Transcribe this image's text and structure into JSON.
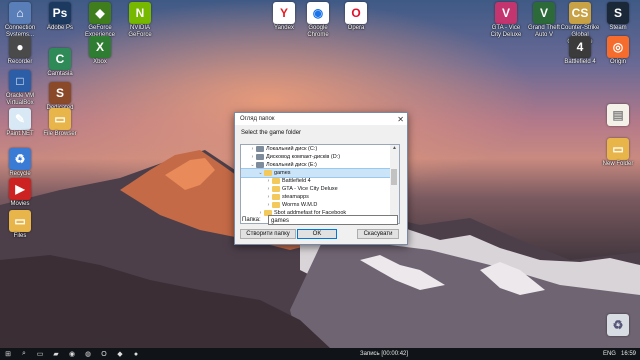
{
  "desktop": {
    "left_icons": [
      {
        "label": "Connection Systems...",
        "icon": "computer-icon",
        "color": "#5a7fb8",
        "glyph": "⌂"
      },
      {
        "label": "Oracle VM VirtualBox",
        "icon": "virtualbox-icon",
        "color": "#2b5ea7",
        "glyph": "□"
      },
      {
        "label": "Paint.NET",
        "icon": "paint-icon",
        "color": "#d9e8f5",
        "glyph": "✎"
      },
      {
        "label": "Recycle",
        "icon": "recycle-bin-icon",
        "color": "#3a7bd5",
        "glyph": "♻"
      },
      {
        "label": "Movies",
        "icon": "movie-icon",
        "color": "#cc2222",
        "glyph": "▶"
      },
      {
        "label": "Adobe Ps",
        "icon": "photoshop-icon",
        "color": "#1c3a5f",
        "glyph": "Ps"
      },
      {
        "label": "Camtasia",
        "icon": "camtasia-icon",
        "color": "#2e8b57",
        "glyph": "C"
      },
      {
        "label": "Dedicated Server",
        "icon": "server-icon",
        "color": "#8a4a2a",
        "glyph": "S"
      },
      {
        "label": "GeForce Experience",
        "icon": "geforce-icon",
        "color": "#3f7d1d",
        "glyph": "◆"
      },
      {
        "label": "NVIDIA GeForce",
        "icon": "nvidia-icon",
        "color": "#76b900",
        "glyph": "N"
      },
      {
        "label": "Recorder",
        "icon": "recorder-icon",
        "color": "#4a4a4a",
        "glyph": "●"
      },
      {
        "label": "File Browser",
        "icon": "folder-icon",
        "color": "#e8b54a",
        "glyph": "▭"
      },
      {
        "label": "Files",
        "icon": "folder-icon",
        "color": "#e8b54a",
        "glyph": "▭"
      },
      {
        "label": "Xbox",
        "icon": "xbox-icon",
        "color": "#2f7d32",
        "glyph": "X"
      }
    ],
    "top_icons": [
      {
        "label": "Yandex",
        "icon": "yandex-icon",
        "color": "#ffffff",
        "glyph": "Y",
        "fg": "#e31e24"
      },
      {
        "label": "Google Chrome",
        "icon": "chrome-icon",
        "color": "#ffffff",
        "glyph": "◉",
        "fg": "#1a73e8"
      },
      {
        "label": "Opera",
        "icon": "opera-icon",
        "color": "#ffffff",
        "glyph": "O",
        "fg": "#e0102b"
      }
    ],
    "right_icons": [
      {
        "label": "GTA - Vice City Deluxe",
        "icon": "gta-vice-city-icon",
        "color": "#c2356f",
        "glyph": "V"
      },
      {
        "label": "Grand Theft Auto V",
        "icon": "gta-v-icon",
        "color": "#2d6a3a",
        "glyph": "V"
      },
      {
        "label": "Counter-Strike Global Offensive",
        "icon": "csgo-icon",
        "color": "#c8a245",
        "glyph": "CS"
      },
      {
        "label": "Steam",
        "icon": "steam-icon",
        "color": "#1b2838",
        "glyph": "S"
      },
      {
        "label": "Battlefield 4",
        "icon": "battlefield-icon",
        "color": "#3b3b3b",
        "glyph": "4"
      },
      {
        "label": "Origin",
        "icon": "origin-icon",
        "color": "#f56c2d",
        "glyph": "◎"
      },
      {
        "label": "",
        "icon": "file-icon",
        "color": "#f4f1e8",
        "glyph": "▤",
        "fg": "#888"
      },
      {
        "label": "New Folder",
        "icon": "folder-icon",
        "color": "#e8b54a",
        "glyph": "▭"
      },
      {
        "label": "",
        "icon": "recycle-bin-icon",
        "color": "#d8dde4",
        "glyph": "♻",
        "fg": "#557"
      }
    ]
  },
  "dialog": {
    "title": "Огляд папок",
    "close_glyph": "✕",
    "instruction": "Select the game folder",
    "tree": [
      {
        "label": "Локальний диск (C:)",
        "type": "drive",
        "indent": 1,
        "expanded": false
      },
      {
        "label": "Дисковод компакт-дисків (D:)",
        "type": "drive",
        "indent": 1,
        "expanded": false
      },
      {
        "label": "Локальний диск (E:)",
        "type": "drive",
        "indent": 1,
        "expanded": true
      },
      {
        "label": "games",
        "type": "folder",
        "indent": 2,
        "expanded": true,
        "selected": true
      },
      {
        "label": "Battlefield 4",
        "type": "folder",
        "indent": 3,
        "expanded": false
      },
      {
        "label": "GTA - Vice City Deluxe",
        "type": "folder",
        "indent": 3,
        "expanded": false
      },
      {
        "label": "steamapps",
        "type": "folder",
        "indent": 3,
        "expanded": false
      },
      {
        "label": "Worms W.M.D",
        "type": "folder",
        "indent": 3,
        "expanded": false
      },
      {
        "label": "Sbot addmefast for Facebook",
        "type": "folder",
        "indent": 2,
        "expanded": false
      }
    ],
    "folder_label": "Папка:",
    "folder_value": "games",
    "buttons": {
      "new_folder": "Створити папку",
      "ok": "OK",
      "cancel": "Скасувати"
    }
  },
  "taskbar": {
    "items": [
      {
        "icon": "start-icon",
        "glyph": "⊞"
      },
      {
        "icon": "search-icon",
        "glyph": "⌕"
      },
      {
        "icon": "task-view-icon",
        "glyph": "▭"
      },
      {
        "icon": "explorer-icon",
        "glyph": "▰"
      },
      {
        "icon": "chrome-icon",
        "glyph": "◉"
      },
      {
        "icon": "steam-icon",
        "glyph": "◍"
      },
      {
        "icon": "opera-icon",
        "glyph": "O"
      },
      {
        "icon": "app-icon",
        "glyph": "◆"
      },
      {
        "icon": "recorder-icon",
        "glyph": "●"
      }
    ],
    "recording": "Запись [00:00:42]",
    "language": "ENG",
    "time": "16:59"
  }
}
